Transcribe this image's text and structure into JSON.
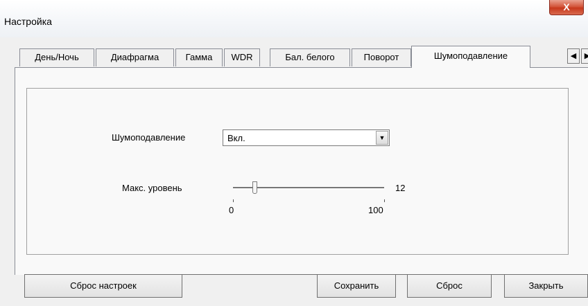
{
  "window": {
    "title": "Настройка",
    "close_label": "X"
  },
  "tabs": [
    {
      "label": "День/Ночь"
    },
    {
      "label": "Диафрагма"
    },
    {
      "label": "Гамма"
    },
    {
      "label": "WDR"
    },
    {
      "label": "Бал. белого"
    },
    {
      "label": "Поворот"
    },
    {
      "label": "Шумоподавление",
      "active": true
    }
  ],
  "tab_scroll": {
    "left": "◀",
    "right": "▶"
  },
  "noise": {
    "label": "Шумоподавление",
    "selected": "Вкл."
  },
  "level": {
    "label": "Макс. уровень",
    "value": "12",
    "min": "0",
    "max": "100"
  },
  "buttons": {
    "reset_settings": "Сброс настроек",
    "save": "Сохранить",
    "reset": "Сброс",
    "close": "Закрыть"
  }
}
